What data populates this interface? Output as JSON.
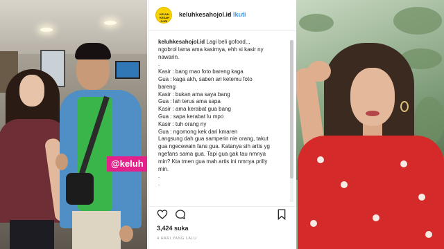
{
  "overlay_tag": "@keluh",
  "post": {
    "avatar_text": "KELUH KESAH OJOL",
    "username": "keluhkesahojol.id",
    "separator": "•",
    "follow_label": "Ikuti",
    "caption_user": "keluhkesahojol.id",
    "caption_first": " Lagi beli gofood,,,",
    "caption_lines": [
      "ngobrol lama ama kasirnya, ehh si kasir ny",
      "nawarin.",
      ".",
      "Kasir : bang mao foto bareng kaga",
      "Gua : kaga akh, saben ari ketemu foto",
      "bareng",
      "Kasir : bukan ama saya bang",
      "Gua : lah terus ama sapa",
      "Kasir : ama kerabat gua bang",
      "Gua : sapa kerabat lu mpo",
      "Kasir : tuh orang ny",
      "Gua : ngomong kek dari kmaren",
      "Langsung dah gua samperin nie orang, takut",
      "gua ngecewain fans gua. Katanya sih artis yg",
      "ngefans sama gua. Tapi gua gak tau nmnya",
      "min? Kta tmen gua mah artis ini nmnya prilly",
      "min.",
      ".",
      "."
    ],
    "likes": "3,424 suka",
    "time": "4 HARI YANG LALU",
    "icons": [
      "heart-icon",
      "comment-icon",
      "bookmark-icon"
    ]
  }
}
